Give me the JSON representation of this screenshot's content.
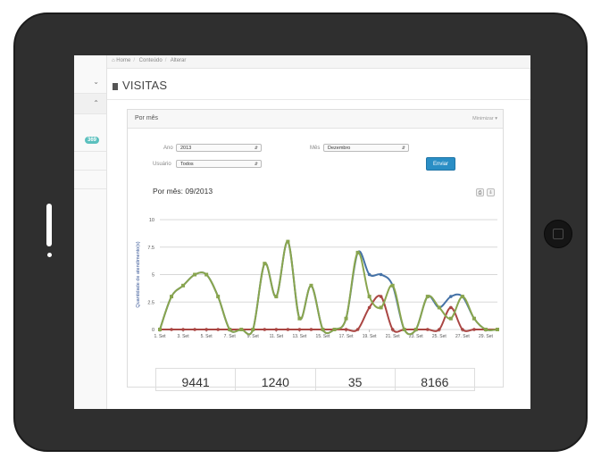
{
  "breadcrumb": {
    "items": [
      "Home",
      "Conteúdo",
      "Alterar"
    ]
  },
  "page": {
    "title": "VISITAS"
  },
  "sidebar": {
    "badge": "369"
  },
  "panel": {
    "title": "Por mês",
    "minimize_label": "Minimizar"
  },
  "form": {
    "ano_label": "Ano",
    "ano_value": "2013",
    "mes_label": "Mês",
    "mes_value": "Dezembro",
    "usuario_label": "Usuário",
    "usuario_value": "Todos",
    "submit_label": "Enviar"
  },
  "chart_data": {
    "type": "line",
    "title": "Por mês: 09/2013",
    "ylabel": "Quantidade de atendimento(s)",
    "xlabel": "",
    "ylim": [
      0,
      10
    ],
    "yticks": [
      0,
      2.5,
      5,
      7.5,
      10
    ],
    "x": [
      1,
      2,
      3,
      4,
      5,
      6,
      7,
      8,
      9,
      10,
      11,
      12,
      13,
      14,
      15,
      16,
      17,
      18,
      19,
      20,
      21,
      22,
      23,
      24,
      25,
      26,
      27,
      28,
      29,
      30
    ],
    "x_tick_labels": [
      "1. Set",
      "3. Set",
      "5. Set",
      "7. Set",
      "9. Set",
      "11. Set",
      "13. Set",
      "15. Set",
      "17. Set",
      "19. Set",
      "21. Set",
      "23. Set",
      "25. Set",
      "27. Set",
      "29. Set"
    ],
    "grid": true,
    "series": [
      {
        "color": "#4572a7",
        "values": [
          0,
          3,
          4,
          5,
          5,
          3,
          0,
          0,
          0,
          6,
          3,
          8,
          1,
          4,
          0,
          0,
          1,
          7,
          5,
          5,
          4,
          0,
          0,
          3,
          2,
          3,
          3,
          1,
          0,
          0
        ]
      },
      {
        "color": "#aa4643",
        "values": [
          0,
          0,
          0,
          0,
          0,
          0,
          0,
          0,
          0,
          0,
          0,
          0,
          0,
          0,
          0,
          0,
          0,
          0,
          2,
          3,
          0,
          0,
          0,
          0,
          0,
          2,
          0,
          0,
          0,
          0
        ]
      },
      {
        "color": "#89a54e",
        "values": [
          0,
          3,
          4,
          5,
          5,
          3,
          0,
          0,
          0,
          6,
          3,
          8,
          1,
          4,
          0,
          0,
          1,
          7,
          3,
          2,
          4,
          0,
          0,
          3,
          2,
          1,
          3,
          1,
          0,
          0
        ]
      }
    ]
  },
  "stats": [
    "9441",
    "1240",
    "35",
    "8166"
  ]
}
